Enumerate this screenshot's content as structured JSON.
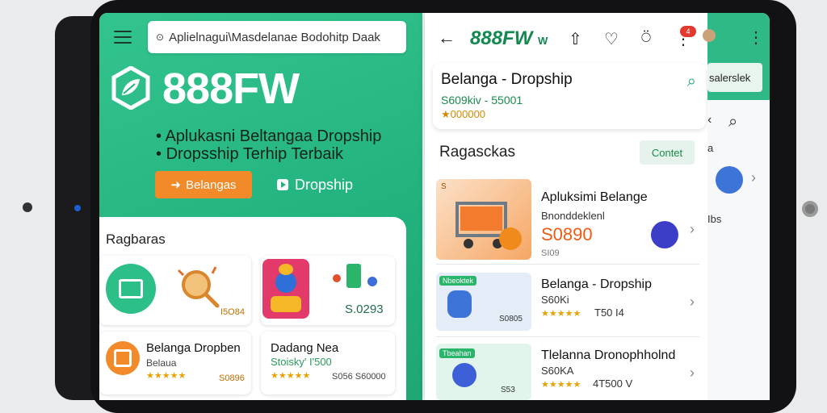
{
  "left": {
    "search_text": "Aplielnagui\\Masdelanae Bodohitp Daak",
    "brand": "888FW",
    "bullets": [
      "Aplukasni Beltangaa Dropship",
      "Dropsship Terhip Terbaik"
    ],
    "btn_primary": "Belangas",
    "btn_secondary": "Dropship",
    "section_title": "Ragbaras",
    "tiles": [
      {
        "price": "I5O84"
      },
      {
        "price": "S.0293"
      },
      {
        "title": "Belanga Dropben",
        "sub": "Belaua",
        "stars": "★★★★★",
        "price": "S0896"
      },
      {
        "title": "Dadang Nea",
        "sub": "Stoisky' I'500",
        "stars": "★★★★★",
        "price": "S056 S60000"
      }
    ]
  },
  "right": {
    "logo": "888FW",
    "logo_small": "W",
    "notif_count": "4",
    "product_title": "Belanga - Dropship",
    "price_1": "S609kiv - 55001",
    "price_2": "★000000",
    "section_title": "Ragasckas",
    "contact_btn": "Contet",
    "items": [
      {
        "name": "Apluksimi Belange",
        "l2": "Bnonddeklenl",
        "price": "S0890",
        "l3": "SI09",
        "badge": "S"
      },
      {
        "name": "Belanga - Dropship",
        "l2": "S60Ki",
        "l3": "★★★★★",
        "extra": "T50 I4",
        "thumb_price": "S0805",
        "thumb_tag": "Nbeoktek"
      },
      {
        "name": "Tlelanna Dronophholnd",
        "l2": "S60KA",
        "l3": "★★★★★",
        "extra": "4T500 V",
        "thumb_price": "S53",
        "thumb_tag": "Tbeahan"
      }
    ]
  },
  "far": {
    "search": "salerslek",
    "letter": "a",
    "small": "Ibs"
  },
  "colors": {
    "green": "#22b27e",
    "orange": "#f28a2a",
    "dark_green": "#1a8b4d"
  }
}
